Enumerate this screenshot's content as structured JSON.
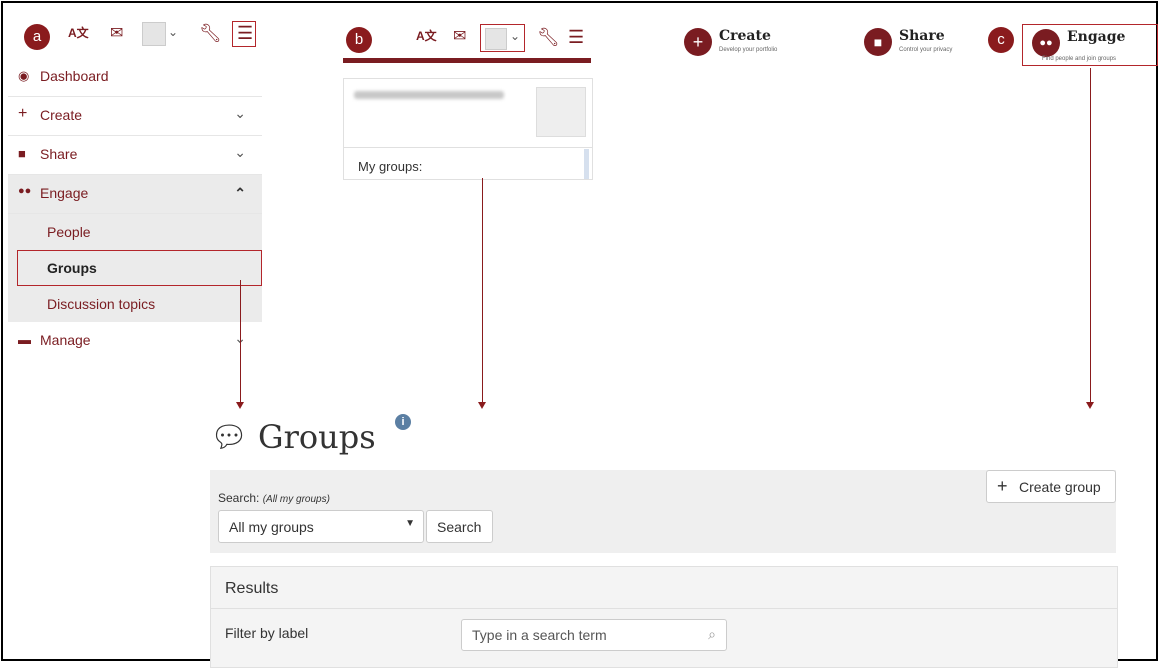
{
  "badges": {
    "a": "a",
    "b": "b",
    "c": "c"
  },
  "sidebar": {
    "items": [
      {
        "label": "Dashboard",
        "icon": "dashboard-icon"
      },
      {
        "label": "Create",
        "icon": "plus-icon"
      },
      {
        "label": "Share",
        "icon": "lock-icon"
      },
      {
        "label": "Engage",
        "icon": "users-icon"
      },
      {
        "label": "Manage",
        "icon": "briefcase-icon"
      }
    ],
    "engage_sub": [
      "People",
      "Groups",
      "Discussion topics"
    ]
  },
  "profile": {
    "my_groups": "My groups:"
  },
  "nav": {
    "create": {
      "title": "Create",
      "subtitle": "Develop your portfolio"
    },
    "share": {
      "title": "Share",
      "subtitle": "Control your privacy"
    },
    "engage": {
      "title": "Engage",
      "subtitle": "Find people and join groups"
    }
  },
  "groups_page": {
    "title": "Groups",
    "create_group": "Create group",
    "search_label": "Search:",
    "search_hint": "(All my groups)",
    "select_value": "All my groups",
    "search_button": "Search",
    "results_title": "Results",
    "filter_label": "Filter by label",
    "filter_placeholder": "Type in a search term"
  },
  "colors": {
    "accent": "#7a1c21",
    "highlight_border": "#b3262b"
  }
}
